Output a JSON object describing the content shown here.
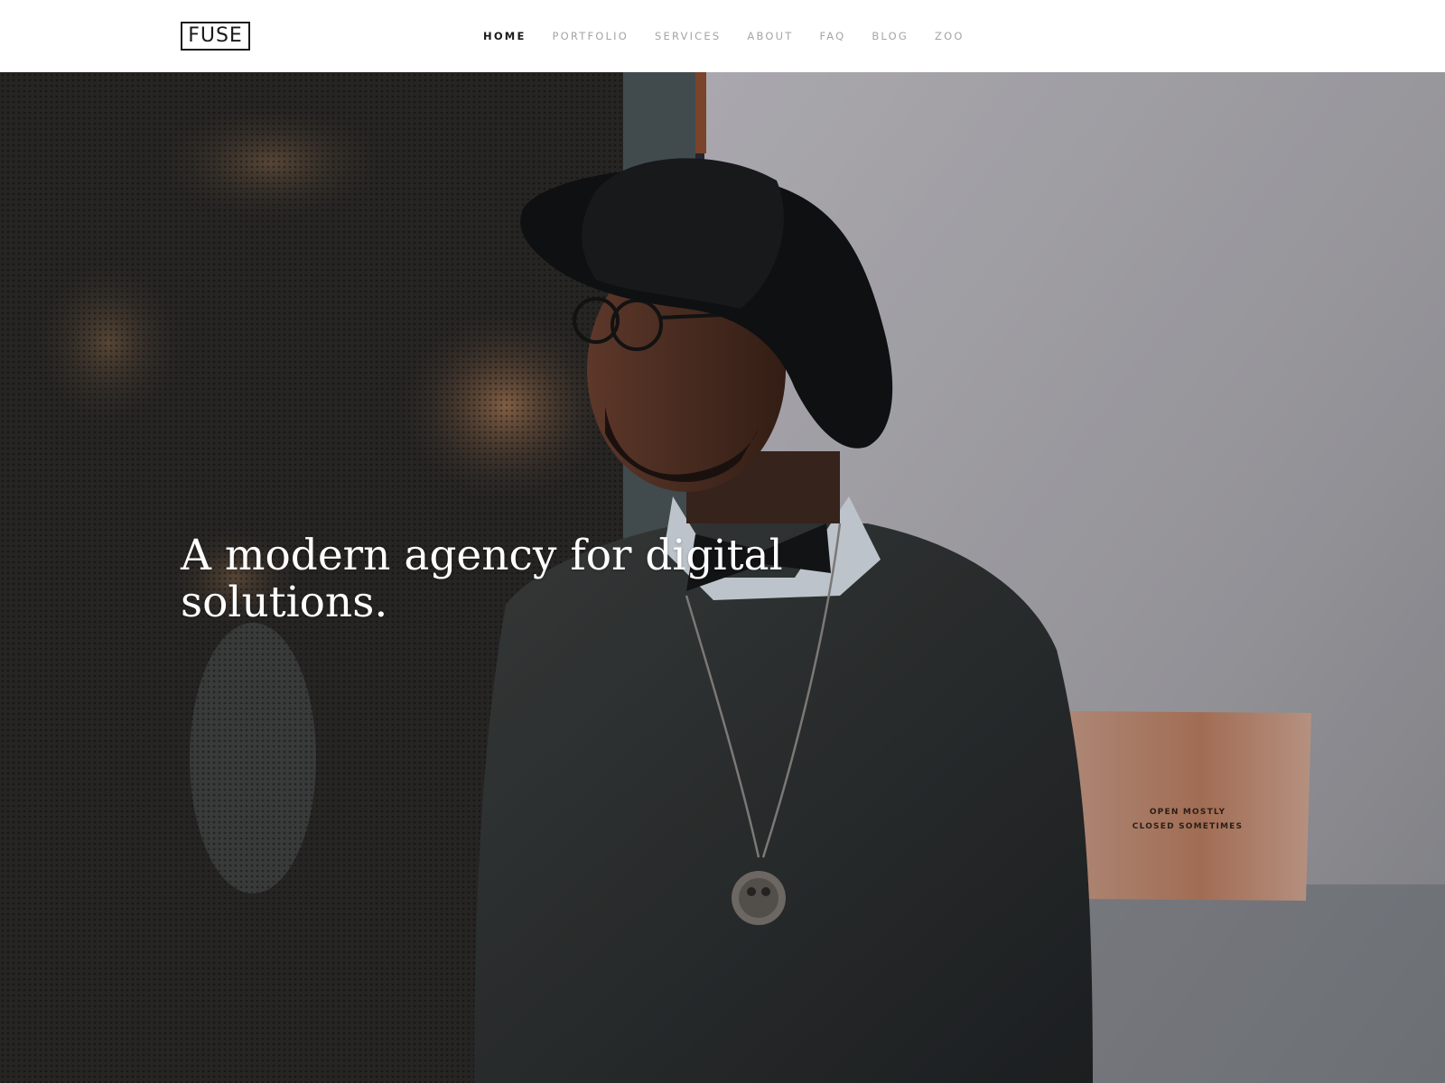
{
  "header": {
    "logo_text": "FUSE",
    "nav": [
      {
        "label": "HOME",
        "active": true
      },
      {
        "label": "PORTFOLIO",
        "active": false
      },
      {
        "label": "SERVICES",
        "active": false
      },
      {
        "label": "ABOUT",
        "active": false
      },
      {
        "label": "FAQ",
        "active": false
      },
      {
        "label": "BLOG",
        "active": false
      },
      {
        "label": "ZOO",
        "active": false
      }
    ]
  },
  "hero": {
    "title": "A modern agency for digital solutions.",
    "sign": {
      "line1": "OPEN MOSTLY",
      "line2": "CLOSED SOMETIMES"
    }
  },
  "colors": {
    "nav_active": "#1a1a1a",
    "nav_inactive": "#a5a5a5",
    "hero_text": "#ffffff"
  }
}
